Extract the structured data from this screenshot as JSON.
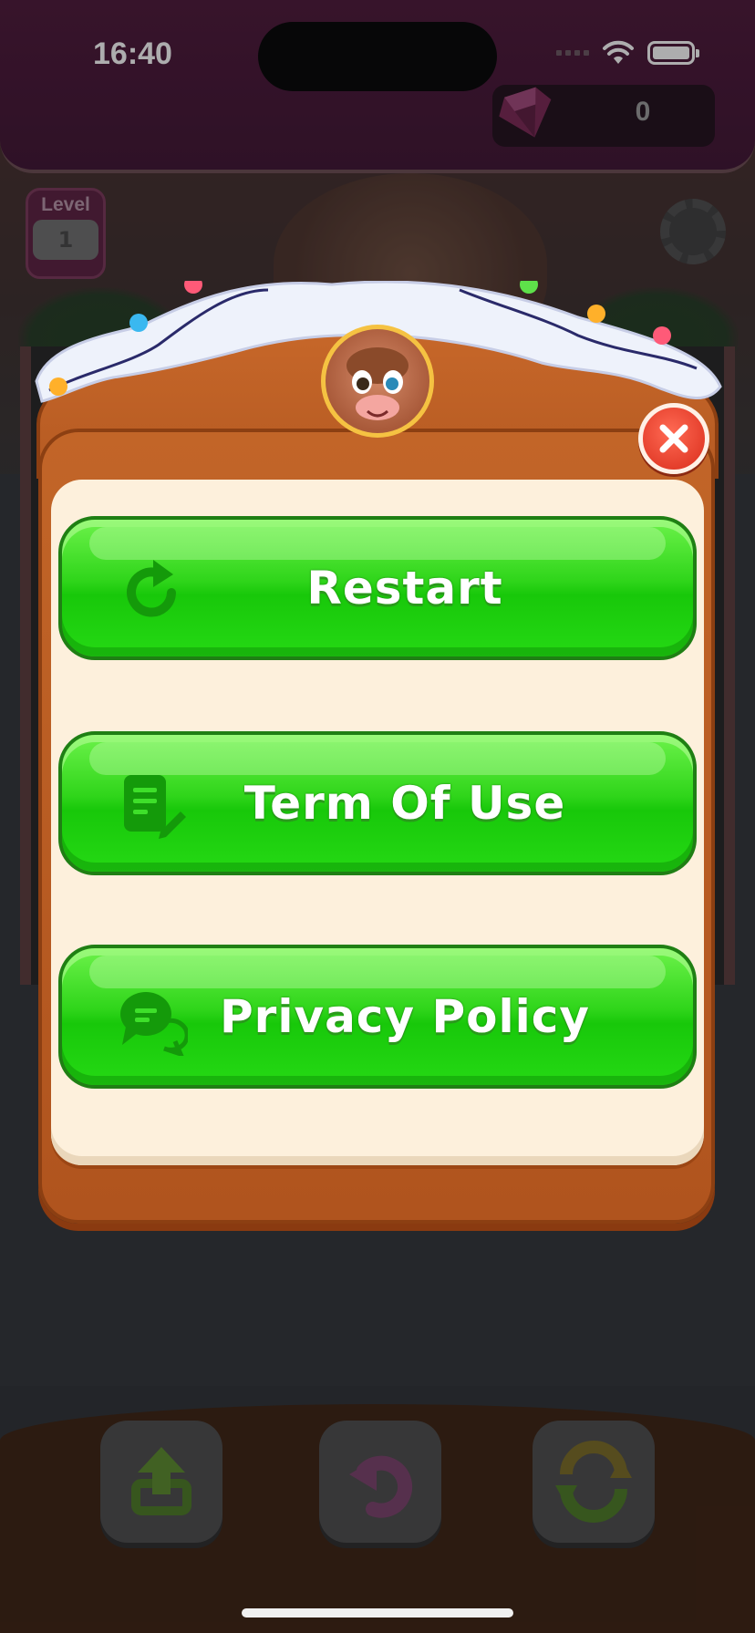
{
  "status_bar": {
    "time": "16:40"
  },
  "hud": {
    "gem_count": "0",
    "level_label": "Level",
    "level_number": "1"
  },
  "dialog": {
    "buttons": [
      {
        "label": "Restart",
        "icon": "restart-icon"
      },
      {
        "label": "Term Of Use",
        "icon": "document-edit-icon"
      },
      {
        "label": "Privacy Policy",
        "icon": "chat-bubbles-icon"
      }
    ],
    "close_icon": "close-icon"
  },
  "toolbar": {
    "tools": [
      "undo-arrow-icon",
      "return-icon",
      "shuffle-icon"
    ]
  },
  "colors": {
    "button_green": "#2fd51a",
    "frame_orange": "#c26528",
    "panel_cream": "#fdf0dc",
    "close_red": "#e23a24",
    "top_bar_purple": "#4b1436"
  }
}
